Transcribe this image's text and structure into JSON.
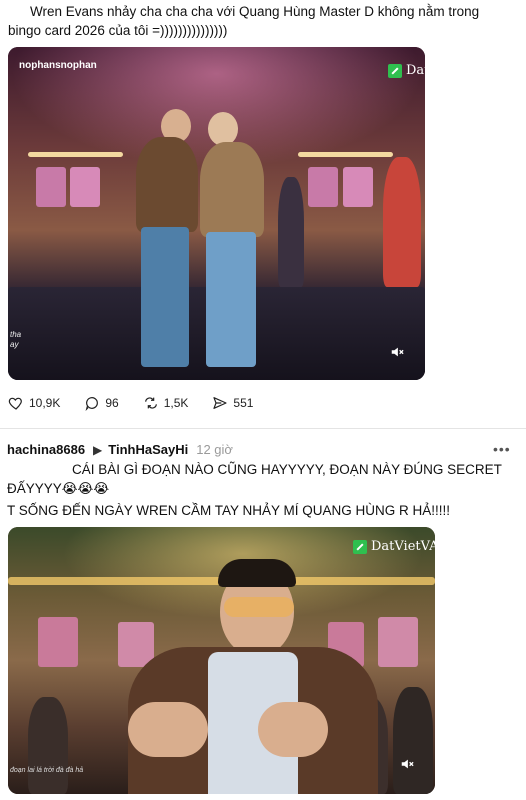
{
  "post": {
    "text_line1": "Wren Evans nhảy cha cha cha với Quang Hùng Master D không nằm trong",
    "text_line2": "bingo card 2026 của tôi =)))))))))))))))",
    "video": {
      "watermark": "nophansnophan",
      "brand": "Dat",
      "side_caption_line1": "tha",
      "side_caption_line2": "ay",
      "mute_icon": "speaker-muted-icon"
    },
    "actions": {
      "likes": "10,9K",
      "comments": "96",
      "reposts": "1,5K",
      "shares": "551"
    }
  },
  "reply": {
    "username": "hachina8686",
    "reply_to": "TinhHaSayHi",
    "time": "12 giờ",
    "more": "•••",
    "line1": "CÁI BÀI GÌ ĐOẠN NÀO CŨNG HAYYYYY, ĐOẠN NÀY ĐÚNG SECRET",
    "line2": "ĐẤYYYY😭😭😭",
    "line3": "T SỐNG ĐẾN NGÀY WREN CẦM TAY NHẢY MÍ QUANG HÙNG R HẢ!!!!!",
    "video": {
      "brand": "DatVietVAC",
      "subtitle": "đoạn lai lá trời đà đà hả",
      "mute_icon": "speaker-muted-icon"
    }
  },
  "colors": {
    "brand_green": "#2fbf4f",
    "muted_text": "#9a9a9a"
  }
}
